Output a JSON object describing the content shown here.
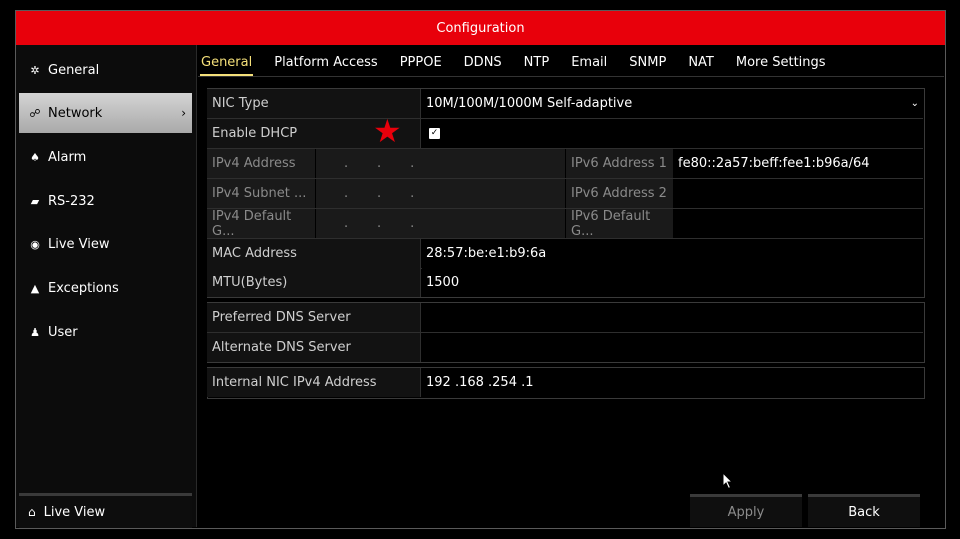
{
  "window": {
    "title": "Configuration"
  },
  "sidebar": {
    "items": [
      {
        "label": "General",
        "icon": "gear-icon"
      },
      {
        "label": "Network",
        "icon": "network-icon"
      },
      {
        "label": "Alarm",
        "icon": "alarm-icon"
      },
      {
        "label": "RS-232",
        "icon": "serial-port-icon"
      },
      {
        "label": "Live View",
        "icon": "eye-icon"
      },
      {
        "label": "Exceptions",
        "icon": "warning-icon"
      },
      {
        "label": "User",
        "icon": "users-icon"
      }
    ],
    "active_index": 1,
    "bottom": {
      "label": "Live View",
      "icon": "home-icon"
    }
  },
  "tabs": [
    "General",
    "Platform Access",
    "PPPOE",
    "DDNS",
    "NTP",
    "Email",
    "SNMP",
    "NAT",
    "More Settings"
  ],
  "form": {
    "nic_type": {
      "label": "NIC Type",
      "value": "10M/100M/1000M Self-adaptive"
    },
    "enable_dhcp": {
      "label": "Enable DHCP",
      "checked": true
    },
    "ipv4_address": {
      "label": "IPv4 Address",
      "value": ".       .       ."
    },
    "ipv4_subnet": {
      "label": "IPv4 Subnet ...",
      "value": ".       .       ."
    },
    "ipv4_gateway": {
      "label": "IPv4 Default G...",
      "value": ".       .       ."
    },
    "ipv6_address_1": {
      "label": "IPv6 Address 1",
      "value": "fe80::2a57:beff:fee1:b96a/64"
    },
    "ipv6_address_2": {
      "label": "IPv6 Address 2",
      "value": ""
    },
    "ipv6_gateway": {
      "label": "IPv6 Default G...",
      "value": ""
    },
    "mac_address": {
      "label": "MAC Address",
      "value": "28:57:be:e1:b9:6a"
    },
    "mtu": {
      "label": "MTU(Bytes)",
      "value": "1500"
    },
    "preferred_dns": {
      "label": "Preferred DNS Server",
      "value": ""
    },
    "alternate_dns": {
      "label": "Alternate DNS Server",
      "value": ""
    },
    "internal_nic": {
      "label": "Internal NIC IPv4 Address",
      "value": "192 .168 .254 .1"
    }
  },
  "buttons": {
    "apply": "Apply",
    "back": "Back"
  },
  "colors": {
    "title_bar": "#e8000b",
    "active_tab": "#f5e07a",
    "star_marker": "#e8000b"
  }
}
